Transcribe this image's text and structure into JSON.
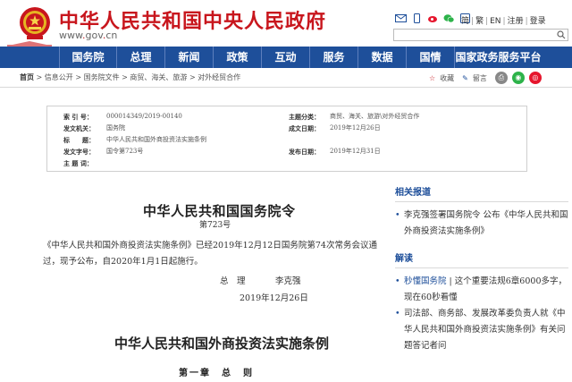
{
  "header": {
    "site_title": "中华人民共和国中央人民政府",
    "site_url_prefix": "www",
    "site_url_domain": "gov",
    "site_url_suffix": "cn",
    "top_links": [
      "简",
      "繁",
      "EN",
      "注册",
      "登录"
    ],
    "icons": [
      "mail-icon",
      "mobile-icon",
      "weibo-icon",
      "wechat-icon",
      "tablet-icon"
    ],
    "colors": {
      "brand_red": "#c8161d",
      "nav_blue": "#1e4f9a"
    }
  },
  "nav": {
    "items": [
      "国务院",
      "总理",
      "新闻",
      "政策",
      "互动",
      "服务",
      "数据",
      "国情",
      "国家政务服务平台"
    ]
  },
  "breadcrumb": {
    "home": "首页",
    "path": [
      "信息公开",
      "国务院文件",
      "商贸、海关、旅游",
      "对外经贸合作"
    ],
    "favorite": "收藏",
    "comment": "留言"
  },
  "info": {
    "index_label": "索 引 号：",
    "index_value": "000014349/2019-00140",
    "topic_label": "主题分类：",
    "topic_value": "商贸、海关、旅游\\对外经贸合作",
    "issuer_label": "发文机关：",
    "issuer_value": "国务院",
    "written_label": "成文日期：",
    "written_value": "2019年12月26日",
    "title_label": "标　　题：",
    "title_value": "中华人民共和国外商投资法实施条例",
    "number_label": "发文字号：",
    "number_value": "国令第723号",
    "publish_label": "发布日期：",
    "publish_value": "2019年12月31日",
    "keywords_label": "主 题 词："
  },
  "main": {
    "order_title": "中华人民共和国国务院令",
    "order_number": "第723号",
    "para_line1": "《中华人民共和国外商投资法实施条例》已经2019年12月12日国务院第74次常务会议通",
    "para_line2": "过，现予公布，自2020年1月1日起施行。",
    "sign_title": "总　理",
    "sign_name": "李克强",
    "sign_date": "2019年12月26日",
    "doc_title": "中华人民共和国外商投资法实施条例",
    "chapter": "第一章　总　则"
  },
  "sidebar": {
    "related_head": "相关报道",
    "related_items": [
      "李克强签署国务院令 公布《中华人民共和国外商投资法实施条例》"
    ],
    "interpret_head": "解读",
    "interpret_src": "秒懂国务院",
    "interpret_items_1": "| 这个重要法规6章6000多字，现在60秒看懂",
    "interpret_items_2": "司法部、商务部、发展改革委负责人就《中华人民共和国外商投资法实施条例》有关问题答记者问"
  }
}
